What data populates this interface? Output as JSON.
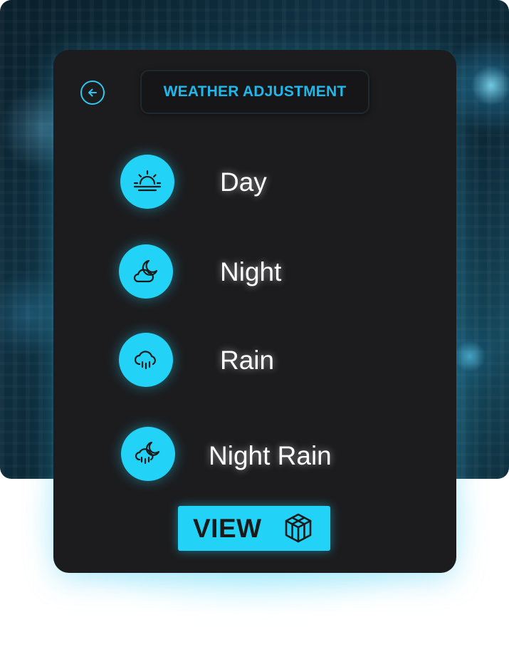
{
  "header": {
    "title": "WEATHER ADJUSTMENT",
    "back_icon": "arrow-left-circle-icon"
  },
  "options": [
    {
      "label": "Day",
      "icon": "sunrise-icon"
    },
    {
      "label": "Night",
      "icon": "cloud-moon-icon"
    },
    {
      "label": "Rain",
      "icon": "cloud-rain-icon"
    },
    {
      "label": "Night Rain",
      "icon": "cloud-moon-rain-icon"
    }
  ],
  "view_button": {
    "label": "VIEW",
    "icon": "cube-3d-icon"
  },
  "colors": {
    "accent": "#22d3f7",
    "title_text": "#1fb8ea",
    "panel": "#1c1c1e",
    "label_text": "#ffffff",
    "button_text": "#1a1a1a"
  }
}
